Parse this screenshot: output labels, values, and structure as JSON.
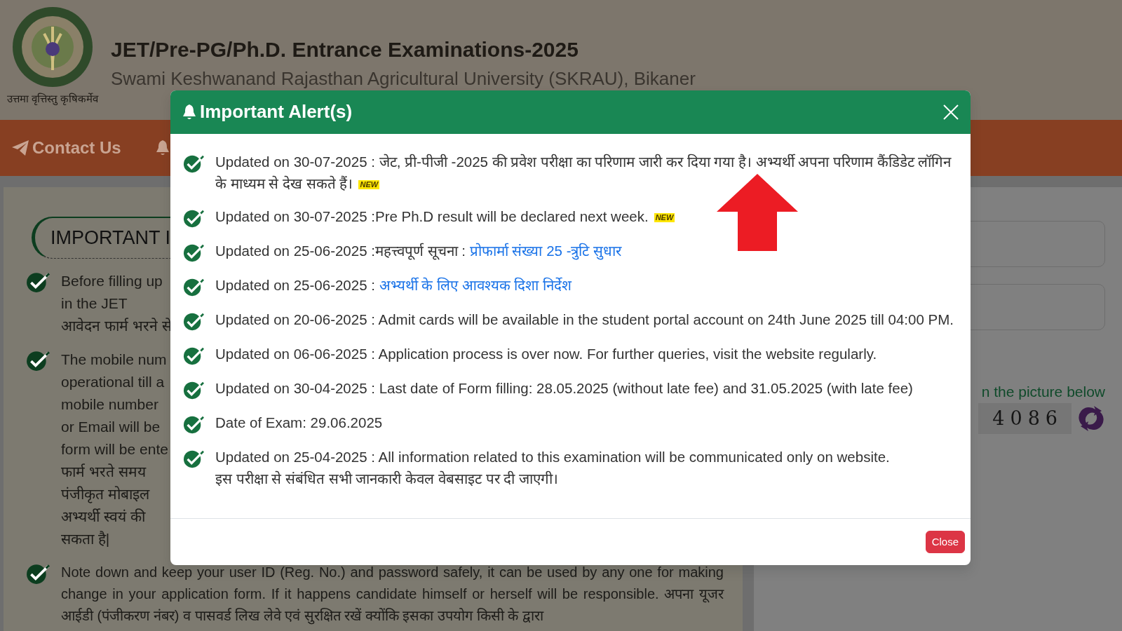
{
  "header": {
    "motto": "उत्तमा वृत्तिस्तु कृषिकर्मेव",
    "title": "JET/Pre-PG/Ph.D. Entrance Examinations-2025",
    "subtitle": "Swami Keshwanand Rajasthan Agricultural University (SKRAU), Bikaner"
  },
  "nav": {
    "items": [
      {
        "label": "Contact Us"
      }
    ]
  },
  "important": {
    "heading": "IMPORTANT I",
    "items": [
      {
        "lines": [
          "Before filling up",
          "in the JET",
          "आवेदन फार्म भरने से"
        ]
      },
      {
        "lines": [
          "The mobile num",
          "operational till a",
          "mobile number",
          "or Email will be",
          "form will be ente",
          "फार्म भरते समय",
          "पंजीकृत मोबाइल",
          "अभ्यर्थी स्वयं की",
          "सकता है|"
        ]
      }
    ],
    "note": "Note down and keep your user ID (Reg. No.) and password safely, it can be used by any one for making change in your application form. If it happens candidate himself or herself will be responsible. अपना यूजर आईडी (पंजीकरण नंबर) व पासवर्ड लिख लेवे एवं सुरक्षित रखें क्योंकि इसका उपयोग किसी के द्वारा"
  },
  "login": {
    "captcha_label": "n the picture below",
    "captcha_text": "4086"
  },
  "modal": {
    "title": "Important Alert(s)",
    "items": [
      {
        "text": "Updated on 30-07-2025 : जेट, प्री-पीजी -2025 की प्रवेश परीक्षा का परिणाम जारी कर दिया गया है। अभ्यर्थी अपना परिणाम कैंडिडेट लॉगिन के माध्यम से देख सकते हैं।",
        "badge": "NEW"
      },
      {
        "text": "Updated on 30-07-2025 :Pre Ph.D result will be declared next week.",
        "badge": "NEW"
      },
      {
        "text": "Updated on 25-06-2025 :महत्त्वपूर्ण सूचना : ",
        "link": "प्रोफार्मा संख्या 25 -त्रुटि सुधार"
      },
      {
        "text": "Updated on 25-06-2025 : ",
        "link": "अभ्यर्थी के लिए आवश्यक दिशा निर्देश"
      },
      {
        "text": "Updated on 20-06-2025 : Admit cards will be available in the student portal account on 24th June 2025 till 04:00 PM."
      },
      {
        "text": "Updated on 06-06-2025 : Application process is over now. For further queries, visit the website regularly."
      },
      {
        "text": "Updated on 30-04-2025 : Last date of Form filling: 28.05.2025 (without late fee) and 31.05.2025 (with late fee)"
      },
      {
        "text": "Date of Exam: 29.06.2025"
      },
      {
        "text": "Updated on 25-04-2025 : All information related to this examination will be communicated only on website.",
        "second_line": "इस परीक्षा से संबंधित सभी जानकारी केवल वेबसाइट पर दी जाएगी।"
      }
    ],
    "close_label": "Close"
  }
}
